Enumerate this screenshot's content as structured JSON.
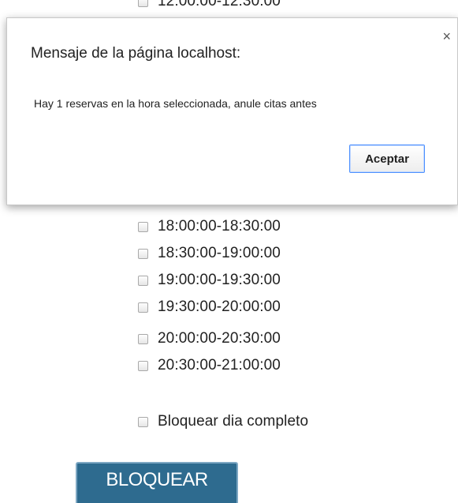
{
  "slots": {
    "clipped_label": "12:00:00-12:30:00",
    "items": [
      {
        "label": "18:00:00-18:30:00"
      },
      {
        "label": "18:30:00-19:00:00"
      },
      {
        "label": "19:00:00-19:30:00"
      },
      {
        "label": "19:30:00-20:00:00"
      },
      {
        "label": "20:00:00-20:30:00"
      },
      {
        "label": "20:30:00-21:00:00"
      }
    ],
    "full_day_label": "Bloquear dia completo"
  },
  "submit": {
    "label": "BLOQUEAR"
  },
  "dialog": {
    "title": "Mensaje de la página localhost:",
    "close_icon": "×",
    "message": "Hay 1 reservas en la hora seleccionada, anule citas antes",
    "ok_label": "Aceptar"
  },
  "colors": {
    "submit_bg": "#2e6b8f",
    "dialog_ok_border": "#4d90fe"
  }
}
